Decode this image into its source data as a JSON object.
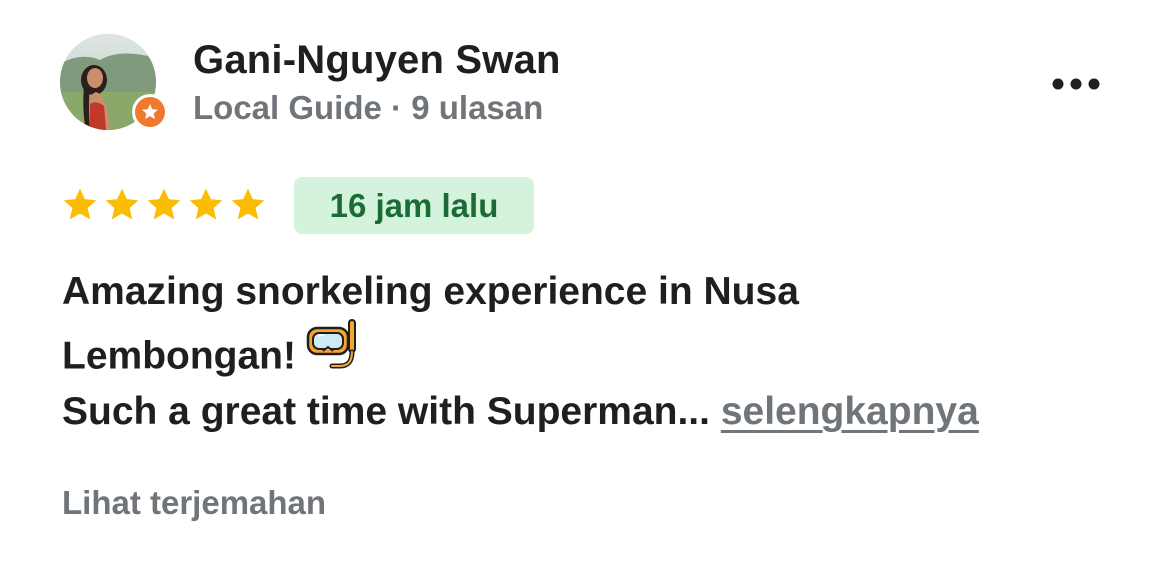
{
  "reviewer": {
    "name": "Gani-Nguyen Swan",
    "role": "Local Guide",
    "separator": "·",
    "reviews_count": "9 ulasan",
    "badge_color": "#ef7a2f"
  },
  "review": {
    "rating": 5,
    "max_rating": 5,
    "star_color": "#fbbc04",
    "time_ago": "16 jam lalu",
    "line1": "Amazing snorkeling experience in Nusa",
    "line2": "Lembongan!",
    "line2_emoji": "diving-mask-emoji",
    "line3": "Such a great time with Superman... ",
    "more_label": "selengkapnya"
  },
  "actions": {
    "translate_label": "Lihat terjemahan",
    "menu_icon": "more-horizontal-icon"
  }
}
